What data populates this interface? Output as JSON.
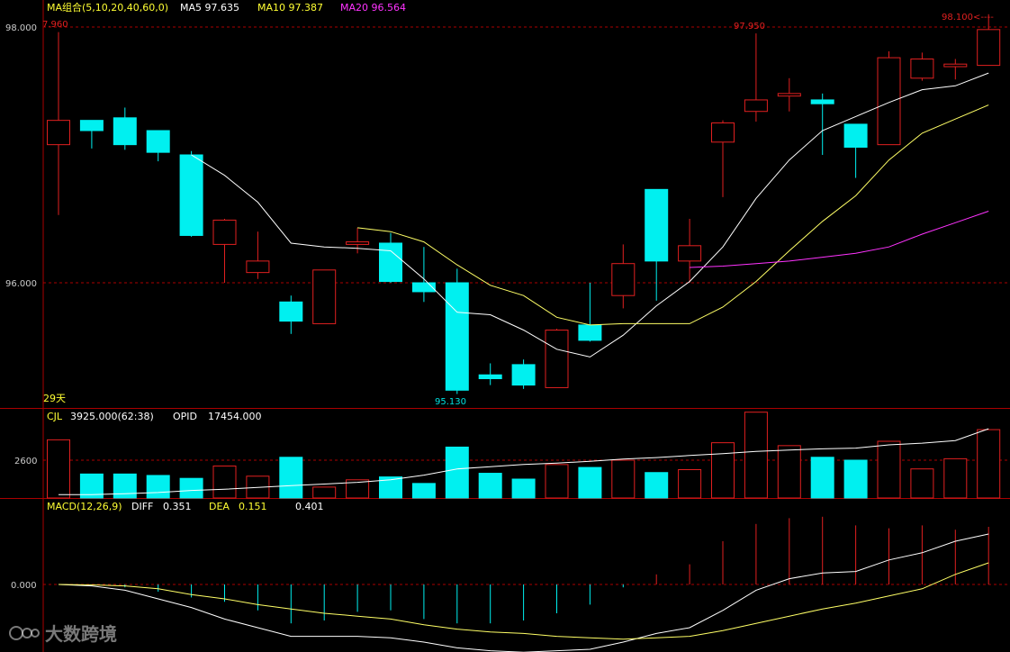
{
  "colors": {
    "up": "#e02020",
    "down": "#00f0f0",
    "ma5": "#ffffff",
    "ma10": "#ffff66",
    "ma20": "#ff33ff",
    "label_yellow": "#ffff33",
    "grid": "#aa0000",
    "axis_text": "#cccccc"
  },
  "header": {
    "ma_group": "MA组合(5,10,20,40,60,0)",
    "ma5": "MA5 97.635",
    "ma10": "MA10 97.387",
    "ma20": "MA20 96.564"
  },
  "annotations": {
    "left_high": "7.960",
    "high_mid": "97.950",
    "high_right": "98.100<----",
    "low": "95.130",
    "days": "29天"
  },
  "price_axis": {
    "ticks": [
      "98.000",
      "96.000"
    ]
  },
  "volume_panel": {
    "cjl_label": "CJL",
    "cjl_value": "3925.000(62:38)",
    "opid_label": "OPID",
    "opid_value": "17454.000",
    "tick": "2600"
  },
  "macd_panel": {
    "title": "MACD(12,26,9)",
    "diff_label": "DIFF",
    "diff_value": "0.351",
    "dea_label": "DEA",
    "dea_value": "0.151",
    "macd_value": "0.401",
    "tick": "0.000"
  },
  "watermark": "大数跨境",
  "chart_data": [
    {
      "type": "candlestick",
      "ylim": [
        95.0,
        98.12
      ],
      "candles": [
        {
          "o": 97.08,
          "h": 97.96,
          "l": 96.53,
          "c": 97.27
        },
        {
          "o": 97.27,
          "h": 97.27,
          "l": 97.05,
          "c": 97.19
        },
        {
          "o": 97.29,
          "h": 97.37,
          "l": 97.04,
          "c": 97.08
        },
        {
          "o": 97.19,
          "h": 97.19,
          "l": 96.95,
          "c": 97.02
        },
        {
          "o": 97.0,
          "h": 97.03,
          "l": 96.36,
          "c": 96.37
        },
        {
          "o": 96.3,
          "h": 96.5,
          "l": 96.0,
          "c": 96.49
        },
        {
          "o": 96.08,
          "h": 96.4,
          "l": 96.03,
          "c": 96.17
        },
        {
          "o": 95.85,
          "h": 95.9,
          "l": 95.6,
          "c": 95.7
        },
        {
          "o": 95.68,
          "h": 96.1,
          "l": 95.68,
          "c": 96.1
        },
        {
          "o": 96.3,
          "h": 96.43,
          "l": 96.23,
          "c": 96.32
        },
        {
          "o": 96.31,
          "h": 96.39,
          "l": 96.0,
          "c": 96.01
        },
        {
          "o": 96.0,
          "h": 96.28,
          "l": 95.85,
          "c": 95.93
        },
        {
          "o": 96.0,
          "h": 96.11,
          "l": 95.13,
          "c": 95.16
        },
        {
          "o": 95.28,
          "h": 95.37,
          "l": 95.2,
          "c": 95.25
        },
        {
          "o": 95.36,
          "h": 95.4,
          "l": 95.17,
          "c": 95.2
        },
        {
          "o": 95.18,
          "h": 95.64,
          "l": 95.18,
          "c": 95.63
        },
        {
          "o": 95.67,
          "h": 96.0,
          "l": 95.54,
          "c": 95.55
        },
        {
          "o": 95.9,
          "h": 96.3,
          "l": 95.8,
          "c": 96.15
        },
        {
          "o": 96.73,
          "h": 96.73,
          "l": 95.86,
          "c": 96.17
        },
        {
          "o": 96.17,
          "h": 96.5,
          "l": 96.0,
          "c": 96.29
        },
        {
          "o": 97.1,
          "h": 97.27,
          "l": 96.67,
          "c": 97.25
        },
        {
          "o": 97.34,
          "h": 97.95,
          "l": 97.26,
          "c": 97.43
        },
        {
          "o": 97.46,
          "h": 97.6,
          "l": 97.34,
          "c": 97.48
        },
        {
          "o": 97.43,
          "h": 97.48,
          "l": 97.0,
          "c": 97.4
        },
        {
          "o": 97.24,
          "h": 97.24,
          "l": 96.82,
          "c": 97.06
        },
        {
          "o": 97.08,
          "h": 97.81,
          "l": 97.08,
          "c": 97.76
        },
        {
          "o": 97.6,
          "h": 97.8,
          "l": 97.58,
          "c": 97.75
        },
        {
          "o": 97.69,
          "h": 97.75,
          "l": 97.59,
          "c": 97.71
        },
        {
          "o": 97.7,
          "h": 98.1,
          "l": 97.7,
          "c": 97.98
        }
      ],
      "ma5": [
        null,
        null,
        null,
        null,
        97.0,
        96.84,
        96.63,
        96.31,
        96.28,
        96.27,
        96.25,
        96.03,
        95.77,
        95.75,
        95.63,
        95.48,
        95.42,
        95.59,
        95.82,
        96.01,
        96.28,
        96.66,
        96.96,
        97.19,
        97.3,
        97.41,
        97.51,
        97.54,
        97.64
      ],
      "ma10": [
        null,
        null,
        null,
        null,
        null,
        null,
        null,
        null,
        null,
        96.43,
        96.4,
        96.32,
        96.14,
        95.98,
        95.9,
        95.73,
        95.67,
        95.68,
        95.68,
        95.68,
        95.81,
        96.01,
        96.25,
        96.48,
        96.68,
        96.96,
        97.17,
        97.28,
        97.39
      ],
      "ma20": [
        null,
        null,
        null,
        null,
        null,
        null,
        null,
        null,
        null,
        null,
        null,
        null,
        null,
        null,
        null,
        null,
        null,
        null,
        null,
        96.12,
        96.13,
        96.15,
        96.17,
        96.2,
        96.23,
        96.28,
        96.38,
        96.47,
        96.56
      ]
    },
    {
      "type": "bar",
      "series_label": "CJL",
      "ylim": [
        0,
        5200
      ],
      "values": [
        4000,
        1650,
        1650,
        1550,
        1350,
        2200,
        1500,
        2800,
        750,
        1250,
        1450,
        1000,
        3500,
        1700,
        1300,
        2300,
        2100,
        2600,
        1750,
        1950,
        3800,
        5900,
        3600,
        2800,
        2600,
        3900,
        2000,
        2700,
        4700
      ],
      "opid": [
        230,
        230,
        300,
        380,
        520,
        600,
        730,
        850,
        960,
        1080,
        1250,
        1570,
        2000,
        2150,
        2300,
        2400,
        2520,
        2680,
        2780,
        2920,
        3050,
        3200,
        3300,
        3380,
        3430,
        3650,
        3770,
        3950,
        4760
      ]
    },
    {
      "type": "bar",
      "series_label": "MACD",
      "ylim": [
        -0.5,
        0.5
      ],
      "histogram": [
        0,
        -0.005,
        -0.02,
        -0.05,
        -0.09,
        -0.12,
        -0.18,
        -0.27,
        -0.25,
        -0.19,
        -0.18,
        -0.24,
        -0.27,
        -0.27,
        -0.25,
        -0.2,
        -0.14,
        -0.02,
        0.07,
        0.14,
        0.3,
        0.42,
        0.46,
        0.47,
        0.41,
        0.39,
        0.41,
        0.38,
        0.4
      ],
      "diff": [
        0,
        -0.01,
        -0.04,
        -0.1,
        -0.16,
        -0.24,
        -0.3,
        -0.36,
        -0.36,
        -0.36,
        -0.37,
        -0.4,
        -0.44,
        -0.46,
        -0.47,
        -0.46,
        -0.45,
        -0.4,
        -0.34,
        -0.3,
        -0.18,
        -0.04,
        0.04,
        0.08,
        0.09,
        0.17,
        0.22,
        0.3,
        0.35
      ],
      "dea": [
        0,
        -0.003,
        -0.01,
        -0.03,
        -0.07,
        -0.1,
        -0.14,
        -0.17,
        -0.2,
        -0.22,
        -0.24,
        -0.28,
        -0.31,
        -0.33,
        -0.34,
        -0.36,
        -0.37,
        -0.38,
        -0.37,
        -0.36,
        -0.32,
        -0.27,
        -0.22,
        -0.17,
        -0.13,
        -0.08,
        -0.03,
        0.07,
        0.15
      ]
    }
  ]
}
